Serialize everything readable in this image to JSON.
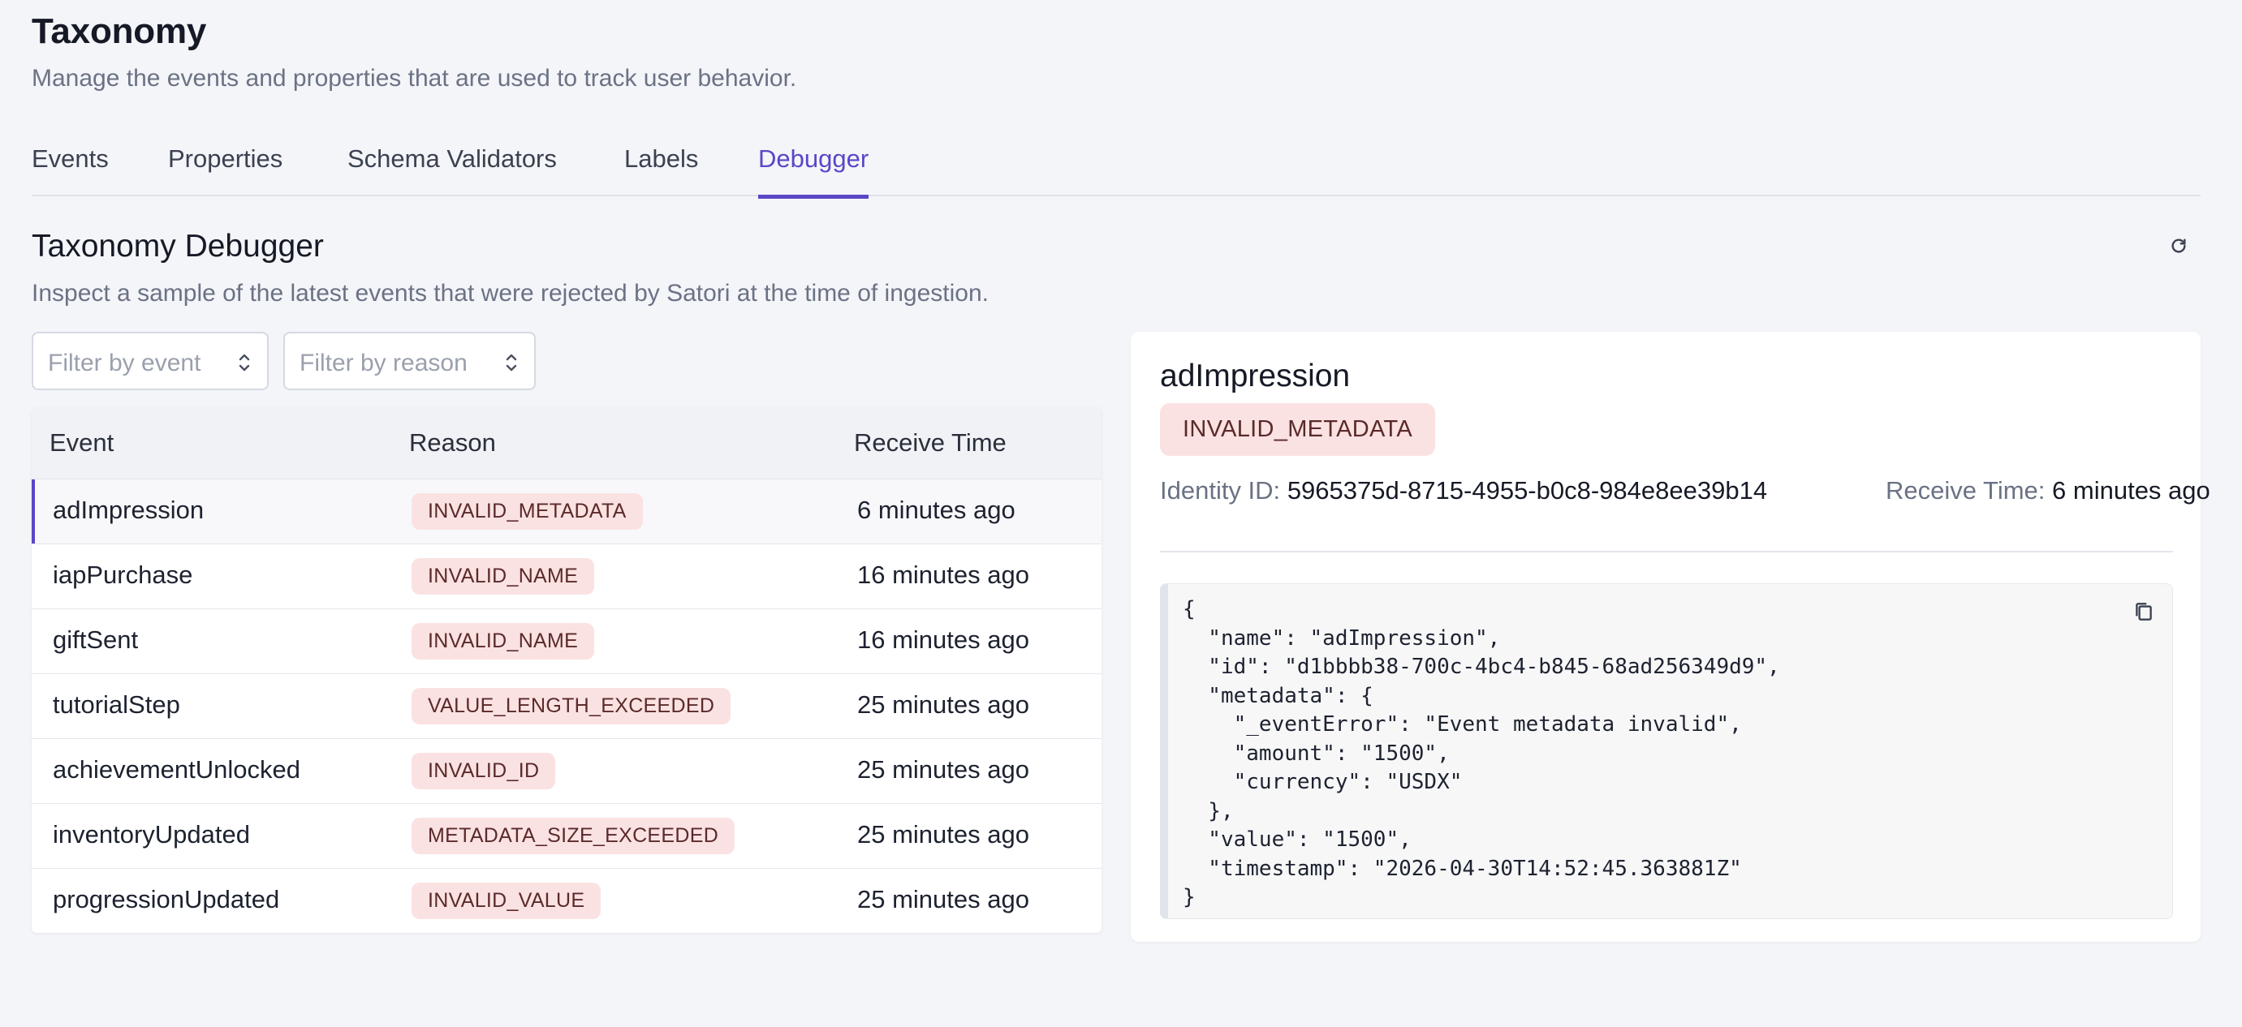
{
  "header": {
    "title": "Taxonomy",
    "subtitle": "Manage the events and properties that are used to track user behavior."
  },
  "tabs": [
    {
      "label": "Events"
    },
    {
      "label": "Properties"
    },
    {
      "label": "Schema Validators"
    },
    {
      "label": "Labels"
    },
    {
      "label": "Debugger",
      "active": true
    }
  ],
  "debugger": {
    "title": "Taxonomy Debugger",
    "subtitle": "Inspect a sample of the latest events that were rejected by Satori at the time of ingestion.",
    "refresh_icon": "refresh-icon"
  },
  "filters": {
    "event_placeholder": "Filter by event",
    "reason_placeholder": "Filter by reason"
  },
  "table": {
    "columns": [
      "Event",
      "Reason",
      "Receive Time"
    ],
    "rows": [
      {
        "event": "adImpression",
        "reason": "INVALID_METADATA",
        "time": "6 minutes ago",
        "selected": true
      },
      {
        "event": "iapPurchase",
        "reason": "INVALID_NAME",
        "time": "16 minutes ago"
      },
      {
        "event": "giftSent",
        "reason": "INVALID_NAME",
        "time": "16 minutes ago"
      },
      {
        "event": "tutorialStep",
        "reason": "VALUE_LENGTH_EXCEEDED",
        "time": "25 minutes ago"
      },
      {
        "event": "achievementUnlocked",
        "reason": "INVALID_ID",
        "time": "25 minutes ago"
      },
      {
        "event": "inventoryUpdated",
        "reason": "METADATA_SIZE_EXCEEDED",
        "time": "25 minutes ago"
      },
      {
        "event": "progressionUpdated",
        "reason": "INVALID_VALUE",
        "time": "25 minutes ago"
      }
    ]
  },
  "detail": {
    "event": "adImpression",
    "reason": "INVALID_METADATA",
    "identity_label": "Identity ID:",
    "identity_value": "5965375d-8715-4955-b0c8-984e8ee39b14",
    "time_label": "Receive Time:",
    "time_value": "6 minutes ago",
    "json": "{\n  \"name\": \"adImpression\",\n  \"id\": \"d1bbbb38-700c-4bc4-b845-68ad256349d9\",\n  \"metadata\": {\n    \"_eventError\": \"Event metadata invalid\",\n    \"amount\": \"1500\",\n    \"currency\": \"USDX\"\n  },\n  \"value\": \"1500\",\n  \"timestamp\": \"2026-04-30T14:52:45.363881Z\"\n}",
    "copy_icon": "copy-icon"
  },
  "colors": {
    "accent": "#5a46c8",
    "badge_bg": "#fbe2e2",
    "background": "#f4f5f9"
  }
}
